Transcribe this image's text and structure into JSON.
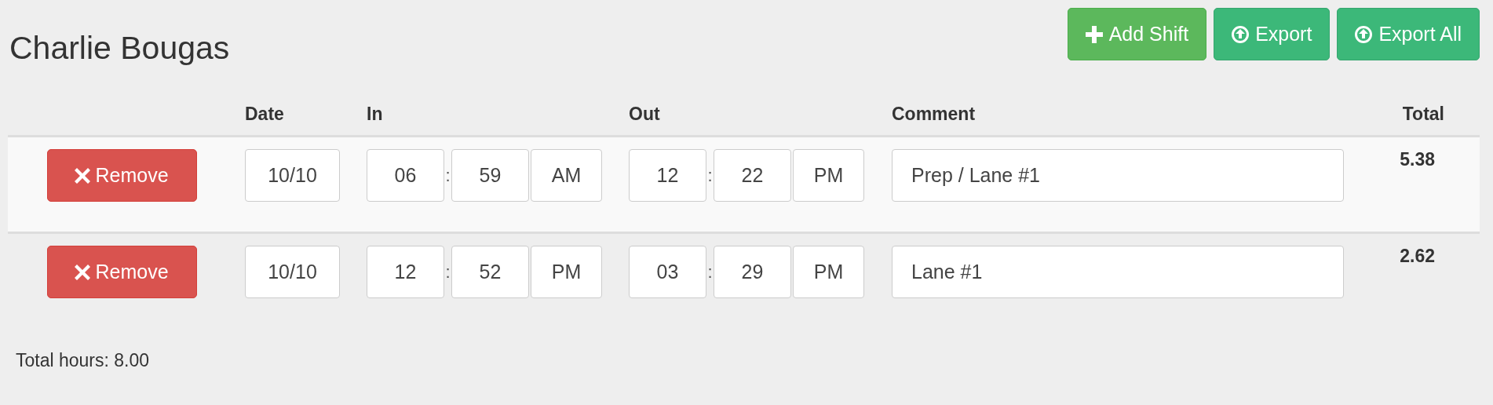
{
  "title": "Charlie Bougas",
  "buttons": [
    {
      "label": "Add Shift",
      "kind": "add"
    },
    {
      "label": "Export",
      "kind": "export"
    },
    {
      "label": "Export All",
      "kind": "export"
    }
  ],
  "columns": [
    "Date",
    "In",
    "Out",
    "Comment",
    "Total"
  ],
  "rows": [
    {
      "remove": "Remove",
      "date": "10/10",
      "in": {
        "hour": "06",
        "sep": ":",
        "minute": "59",
        "ampm": "AM"
      },
      "out": {
        "hour": "12",
        "sep": ":",
        "minute": "22",
        "ampm": "PM"
      },
      "comment": "Prep / Lane #1",
      "total": "5.38"
    },
    {
      "remove": "Remove",
      "date": "10/10",
      "in": {
        "hour": "12",
        "sep": ":",
        "minute": "52",
        "ampm": "PM"
      },
      "out": {
        "hour": "03",
        "sep": ":",
        "minute": "29",
        "ampm": "PM"
      },
      "comment": "Lane #1",
      "total": "2.62"
    }
  ],
  "total_hours": "Total hours: 8.00"
}
